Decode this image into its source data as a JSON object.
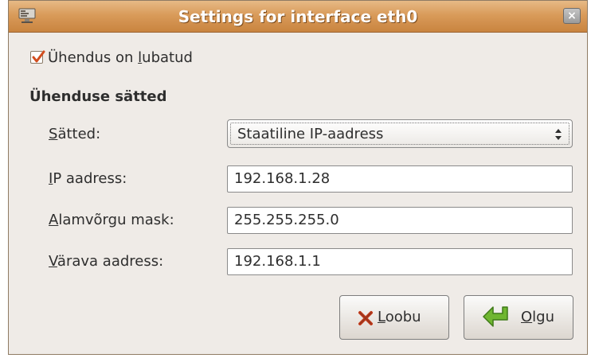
{
  "window": {
    "title": "Settings for interface eth0",
    "close_symbol": "×"
  },
  "enabled": {
    "label_pre": "Ühendus on ",
    "label_underlined": "l",
    "label_post": "ubatud",
    "checked": true
  },
  "section": {
    "title": "Ühenduse sätted"
  },
  "settings": {
    "label_underlined": "S",
    "label_rest": "ätted:",
    "value": "Staatiline IP-aadress"
  },
  "ip": {
    "label_underlined": "I",
    "label_rest": "P aadress:",
    "value": "192.168.1.28"
  },
  "mask": {
    "label_underlined": "A",
    "label_rest": "lamvõrgu mask:",
    "value": "255.255.255.0"
  },
  "gateway": {
    "label_underlined": "V",
    "label_rest": "ärava aadress:",
    "value": "192.168.1.1"
  },
  "buttons": {
    "cancel_underlined": "L",
    "cancel_rest": "oobu",
    "ok_underlined": "O",
    "ok_rest": "lgu"
  },
  "colors": {
    "titlebar": "#d99b5a",
    "window_bg": "#efebe7",
    "check_mark": "#d24d1e",
    "ok_arrow": "#6fb630",
    "cancel_x": "#c23a1a"
  },
  "icons": {
    "title": "network-interface-icon",
    "close": "close-icon",
    "check": "checkmark-icon",
    "combo": "updown-arrows-icon",
    "cancel": "cancel-x-icon",
    "ok": "ok-return-arrow-icon"
  }
}
